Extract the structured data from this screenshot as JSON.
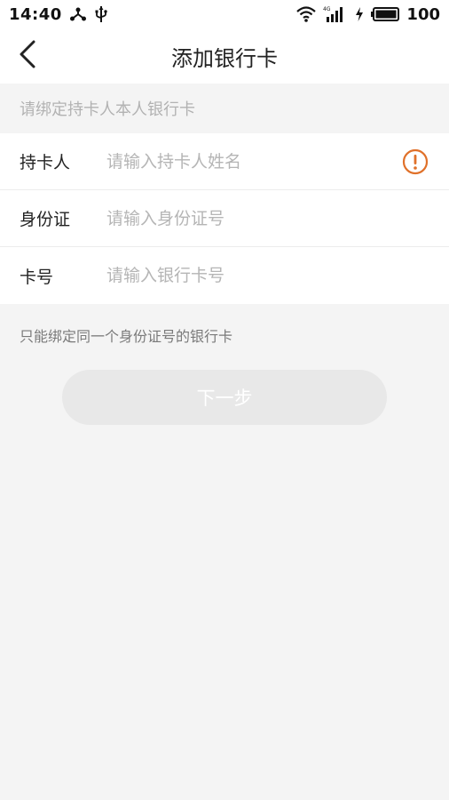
{
  "status_bar": {
    "time": "14:40",
    "battery": "100",
    "icons": [
      "share-icon",
      "usb-icon",
      "wifi-icon",
      "signal-4g-icon",
      "charging-icon",
      "battery-icon"
    ]
  },
  "nav": {
    "title": "添加银行卡",
    "back_icon": "chevron-left-icon"
  },
  "form": {
    "top_hint": "请绑定持卡人本人银行卡",
    "rows": [
      {
        "label": "持卡人",
        "placeholder": "请输入持卡人姓名",
        "value": "",
        "has_warning": true
      },
      {
        "label": "身份证",
        "placeholder": "请输入身份证号",
        "value": ""
      },
      {
        "label": "卡号",
        "placeholder": "请输入银行卡号",
        "value": ""
      }
    ],
    "bottom_hint": "只能绑定同一个身份证号的银行卡"
  },
  "actions": {
    "next_label": "下一步"
  },
  "colors": {
    "accent_warning": "#e0712a",
    "background": "#f4f4f4",
    "button_disabled": "#e8e8e8"
  }
}
